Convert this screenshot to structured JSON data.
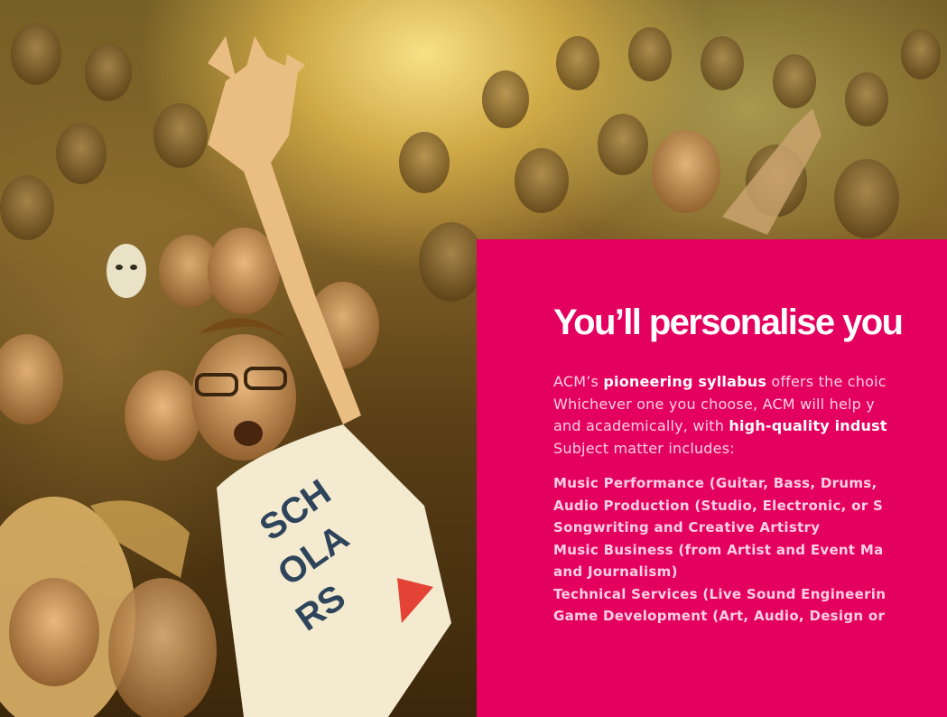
{
  "hero": {
    "image_description_icon": "crowd-photo"
  },
  "card": {
    "background_color": "#e3005f",
    "heading": "You’ll personalise you",
    "intro": {
      "line1_prefix": "ACM’s ",
      "line1_bold": "pioneering syllabus",
      "line1_suffix": " offers the choic",
      "line2": "Whichever one you choose, ACM will help y",
      "line3_prefix": "and academically, with ",
      "line3_bold": "high-quality indust",
      "line4": "Subject matter includes:"
    },
    "subjects": [
      "Music Performance (Guitar, Bass, Drums,",
      "Audio Production (Studio, Electronic, or S",
      "Songwriting and Creative Artistry",
      "Music Business (from Artist and Event Ma",
      "and Journalism)",
      "Technical Services (Live Sound Engineerin",
      "Game Development (Art, Audio, Design or"
    ]
  }
}
